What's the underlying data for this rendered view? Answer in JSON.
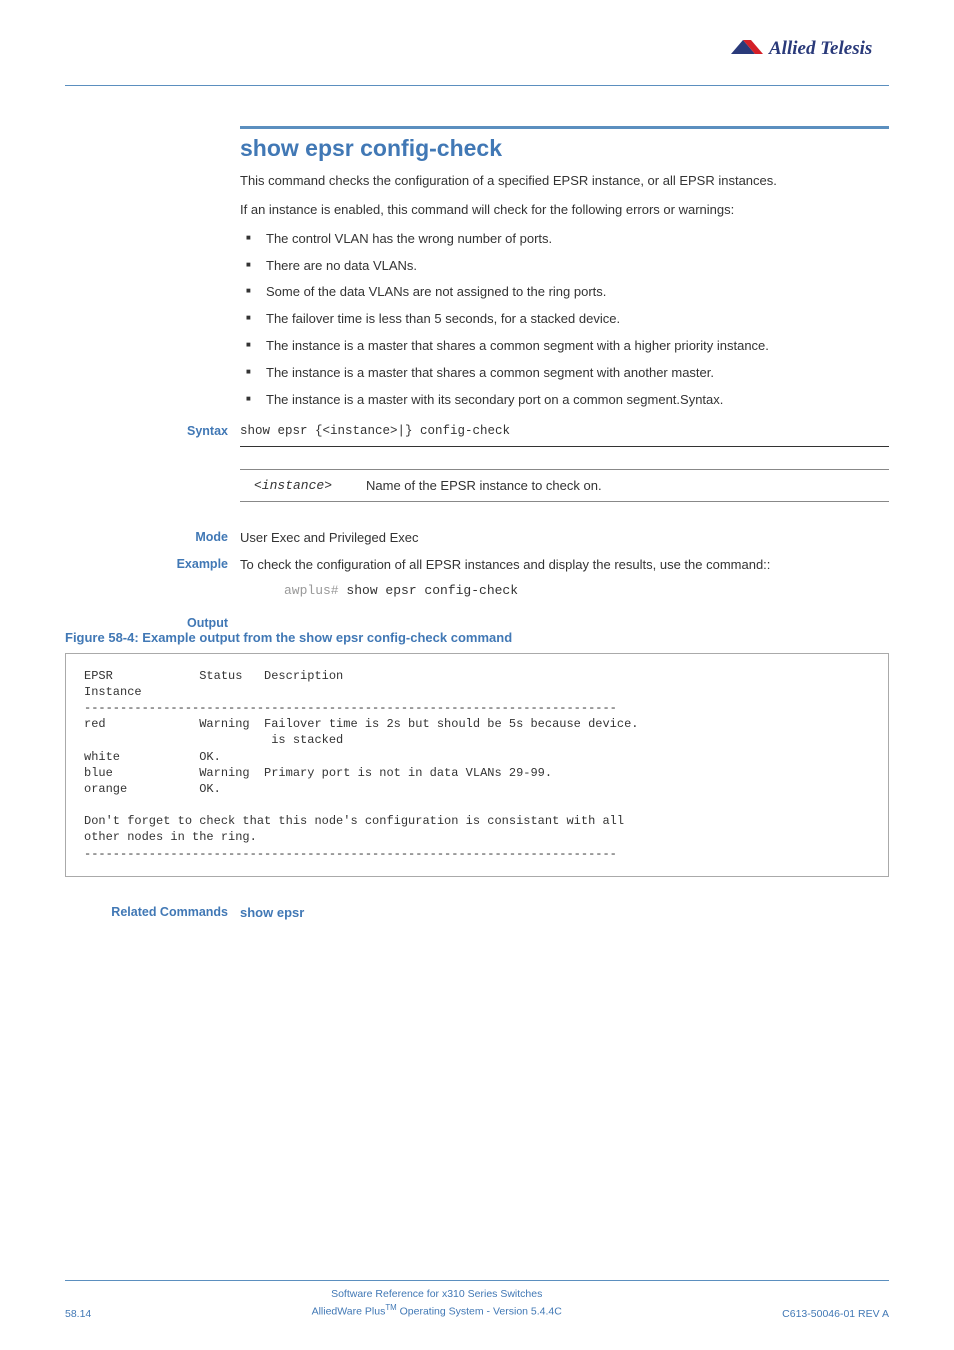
{
  "brand": "Allied Telesis",
  "heading": "show epsr config-check",
  "intro1": "This command checks the configuration of a specified EPSR instance, or all EPSR instances.",
  "intro2": "If an instance is enabled, this command will check for the following errors or warnings:",
  "bullets": [
    "The control VLAN has the wrong number of ports.",
    "There are no data VLANs.",
    "Some of the data VLANs are not assigned to the ring ports.",
    "The failover time is less than 5 seconds, for a stacked device.",
    "The instance is a master that shares a common segment with a higher priority instance.",
    "The instance is a master that shares a common segment with another master.",
    "The instance is a master with its secondary port on a common segment.Syntax."
  ],
  "labels": {
    "syntax": "Syntax",
    "mode": "Mode",
    "example": "Example",
    "output": "Output",
    "related": "Related Commands"
  },
  "syntax_cmd": "show epsr {<instance>|} config-check",
  "param_name": "<instance>",
  "param_desc": "Name of the EPSR instance to check on.",
  "mode_text": "User Exec and Privileged Exec",
  "example_text": "To check the configuration of all EPSR instances and display the results, use the command::",
  "example_prompt": "awplus#",
  "example_cmd": " show epsr config-check",
  "figure_caption": "Figure 58-4: Example output from the show epsr config-check command",
  "output_text": "EPSR            Status   Description\nInstance\n--------------------------------------------------------------------------\nred             Warning  Failover time is 2s but should be 5s because device.\n                          is stacked\nwhite           OK.\nblue            Warning  Primary port is not in data VLANs 29-99.\norange          OK.\n\nDon't forget to check that this node's configuration is consistant with all\nother nodes in the ring.\n--------------------------------------------------------------------------",
  "related_link": "show epsr",
  "footer": {
    "left": "58.14",
    "center1": "Software Reference for x310 Series Switches",
    "center2_pre": "AlliedWare Plus",
    "center2_tm": "TM",
    "center2_post": " Operating System  - Version 5.4.4C",
    "right": "C613-50046-01 REV A"
  }
}
